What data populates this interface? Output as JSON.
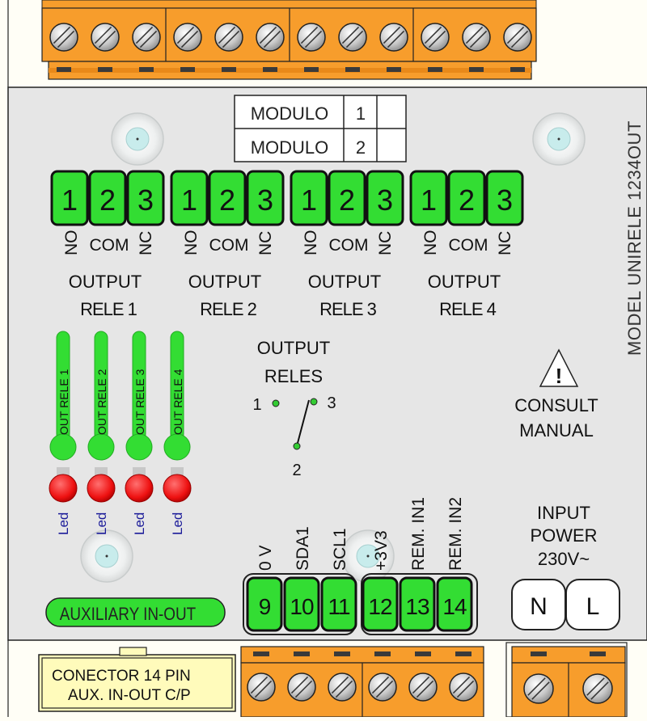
{
  "module_table": {
    "rows": [
      {
        "label": "MODULO",
        "num": "1"
      },
      {
        "label": "MODULO",
        "num": "2"
      }
    ]
  },
  "model_text": "MODEL UNIRELE 1234OUT",
  "relay_terminals": {
    "pin_numbers": [
      "1",
      "2",
      "3"
    ],
    "pin_labels": [
      "NO",
      "COM",
      "NC"
    ],
    "output_label": "OUTPUT",
    "groups": [
      {
        "rele_label": "RELE 1"
      },
      {
        "rele_label": "RELE 2"
      },
      {
        "rele_label": "RELE 3"
      },
      {
        "rele_label": "RELE 4"
      }
    ]
  },
  "leds": [
    {
      "bar_label": "OUT RELE 1",
      "led_label": "Led"
    },
    {
      "bar_label": "OUT RELE 2",
      "led_label": "Led"
    },
    {
      "bar_label": "OUT RELE 3",
      "led_label": "Led"
    },
    {
      "bar_label": "OUT RELE 4",
      "led_label": "Led"
    }
  ],
  "output_reles": {
    "line1": "OUTPUT",
    "line2": "RELES",
    "pin1": "1",
    "pin2": "2",
    "pin3": "3"
  },
  "warning": {
    "line1": "CONSULT",
    "line2": "MANUAL"
  },
  "aux_label": "AUXILIARY IN-OUT",
  "aux_terminals": [
    {
      "num": "9",
      "label": "0 V"
    },
    {
      "num": "10",
      "label": "SDA1"
    },
    {
      "num": "11",
      "label": "SCL1"
    },
    {
      "num": "12",
      "label": "+3V3"
    },
    {
      "num": "13",
      "label": "REM. IN1"
    },
    {
      "num": "14",
      "label": "REM. IN2"
    }
  ],
  "power": {
    "line1": "INPUT",
    "line2": "POWER",
    "line3": "230V~",
    "n": "N",
    "l": "L"
  },
  "connector": {
    "line1": "CONECTOR 14 PIN",
    "line2": "AUX. IN-OUT C/P"
  },
  "colors": {
    "body": "#e6e6e6",
    "orange": "#f79d2c",
    "green": "#33dd33",
    "red": "#ee1111",
    "legend": "#fffbbb"
  }
}
